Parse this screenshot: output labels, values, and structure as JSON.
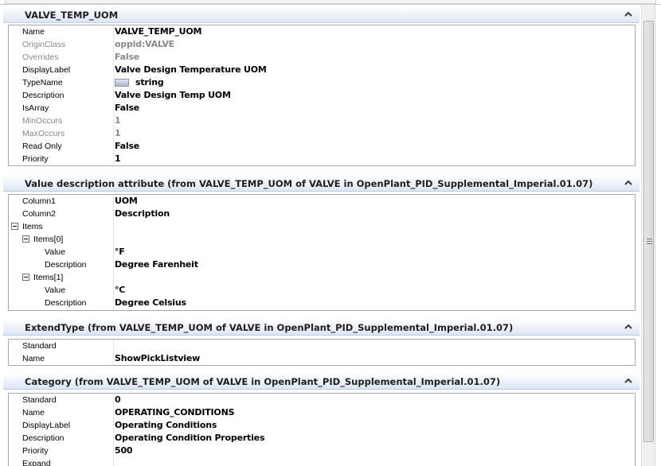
{
  "sections": [
    {
      "title": "VALVE_TEMP_UOM",
      "rows": [
        {
          "label": "Name",
          "value": "VALVE_TEMP_UOM"
        },
        {
          "label": "OriginClass",
          "value": "oppid:VALVE",
          "dim": true
        },
        {
          "label": "Overrides",
          "value": "False",
          "dim": true
        },
        {
          "label": "DisplayLabel",
          "value": "Valve Design Temperature UOM"
        },
        {
          "label": "TypeName",
          "value": "string",
          "icon": "string-type-icon"
        },
        {
          "label": "Description",
          "value": "Valve Design Temp UOM"
        },
        {
          "label": "IsArray",
          "value": "False"
        },
        {
          "label": "MinOccurs",
          "value": "1",
          "dim": true
        },
        {
          "label": "MaxOccurs",
          "value": "1",
          "dim": true
        },
        {
          "label": "Read Only",
          "value": "False"
        },
        {
          "label": "Priority",
          "value": "1"
        }
      ]
    },
    {
      "title": "Value description attribute (from VALVE_TEMP_UOM of VALVE in OpenPlant_PID_Supplemental_Imperial.01.07)",
      "rows": [
        {
          "label": "Column1",
          "value": "UOM"
        },
        {
          "label": "Column2",
          "value": "Description"
        },
        {
          "label": "Items",
          "value": "",
          "expander": true,
          "level": 0
        },
        {
          "label": "Items[0]",
          "value": "",
          "expander": true,
          "level": 1
        },
        {
          "label": "Value",
          "value": "°F",
          "level": 2
        },
        {
          "label": "Description",
          "value": "Degree Farenheit",
          "level": 2
        },
        {
          "label": "Items[1]",
          "value": "",
          "expander": true,
          "level": 1
        },
        {
          "label": "Value",
          "value": "°C",
          "level": 2
        },
        {
          "label": "Description",
          "value": "Degree Celsius",
          "level": 2
        }
      ]
    },
    {
      "title": "ExtendType (from VALVE_TEMP_UOM of VALVE in OpenPlant_PID_Supplemental_Imperial.01.07)",
      "rows": [
        {
          "label": "Standard",
          "value": ""
        },
        {
          "label": "Name",
          "value": "ShowPickListview"
        }
      ]
    },
    {
      "title": "Category (from VALVE_TEMP_UOM of VALVE in OpenPlant_PID_Supplemental_Imperial.01.07)",
      "rows": [
        {
          "label": "Standard",
          "value": "0"
        },
        {
          "label": "Name",
          "value": "OPERATING_CONDITIONS"
        },
        {
          "label": "DisplayLabel",
          "value": "Operating Conditions"
        },
        {
          "label": "Description",
          "value": "Operating Condition Properties"
        },
        {
          "label": "Priority",
          "value": "500"
        },
        {
          "label": "Expand",
          "value": ""
        }
      ]
    }
  ],
  "icons": {
    "collapse": "chevron-up-icon",
    "scrollbar_grip": "grip-icon",
    "tree_expander": "minus-box-icon"
  }
}
